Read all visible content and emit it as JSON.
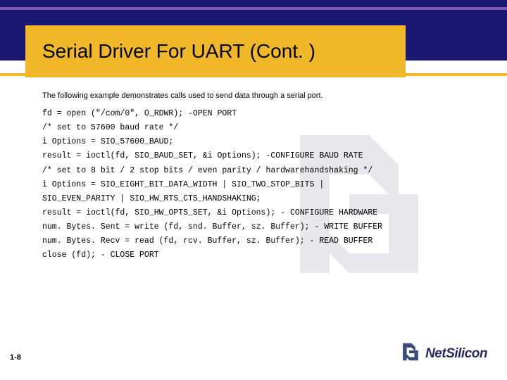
{
  "slide": {
    "title": "Serial Driver For UART (Cont. )",
    "intro": "The following example demonstrates calls used to send data through a serial port.",
    "code": "fd = open (\"/com/0\", O_RDWR); -OPEN PORT\n/* set to 57600 baud rate */\ni Options = SIO_57600_BAUD;\nresult = ioctl(fd, SIO_BAUD_SET, &i Options); -CONFIGURE BAUD RATE\n/* set to 8 bit / 2 stop bits / even parity / hardwarehandshaking */\ni Options = SIO_EIGHT_BIT_DATA_WIDTH | SIO_TWO_STOP_BITS |\nSIO_EVEN_PARITY | SIO_HW_RTS_CTS_HANDSHAKING;\nresult = ioctl(fd, SIO_HW_OPTS_SET, &i Options); - CONFIGURE HARDWARE\nnum. Bytes. Sent = write (fd, snd. Buffer, sz. Buffer); - WRITE BUFFER\nnum. Bytes. Recv = read (fd, rcv. Buffer, sz. Buffer); - READ BUFFER\nclose (fd); - CLOSE PORT"
  },
  "footer": {
    "page": "1-8",
    "brand_prefix": "Net",
    "brand_suffix": "Silicon"
  }
}
